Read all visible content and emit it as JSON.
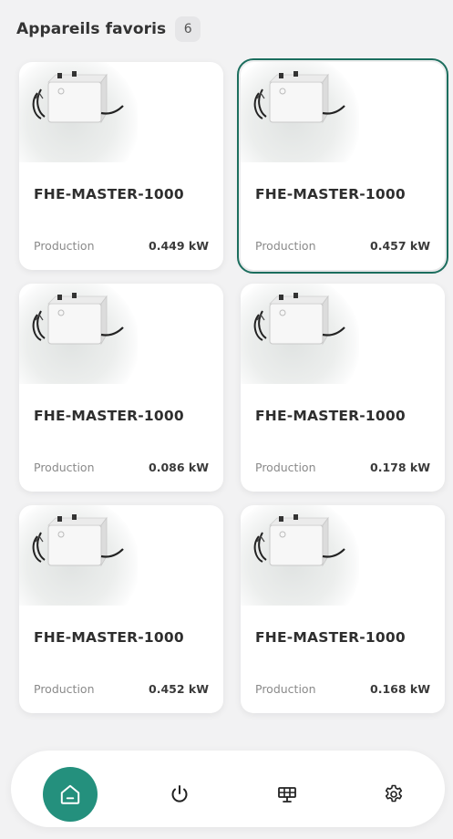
{
  "header": {
    "title": "Appareils favoris",
    "count": "6"
  },
  "devices": [
    {
      "name": "FHE-MASTER-1000",
      "label": "Production",
      "value": "0.449 kW"
    },
    {
      "name": "FHE-MASTER-1000",
      "label": "Production",
      "value": "0.457 kW"
    },
    {
      "name": "FHE-MASTER-1000",
      "label": "Production",
      "value": "0.086 kW"
    },
    {
      "name": "FHE-MASTER-1000",
      "label": "Production",
      "value": "0.178 kW"
    },
    {
      "name": "FHE-MASTER-1000",
      "label": "Production",
      "value": "0.452 kW"
    },
    {
      "name": "FHE-MASTER-1000",
      "label": "Production",
      "value": "0.168 kW"
    }
  ],
  "nav": {
    "items": [
      {
        "icon": "home-icon",
        "active": true
      },
      {
        "icon": "power-icon",
        "active": false
      },
      {
        "icon": "solar-panel-icon",
        "active": false
      },
      {
        "icon": "settings-gear-icon",
        "active": false
      }
    ]
  },
  "colors": {
    "accent": "#24907d",
    "selected_border": "#1c6e5e",
    "background": "#f2f2f3"
  }
}
